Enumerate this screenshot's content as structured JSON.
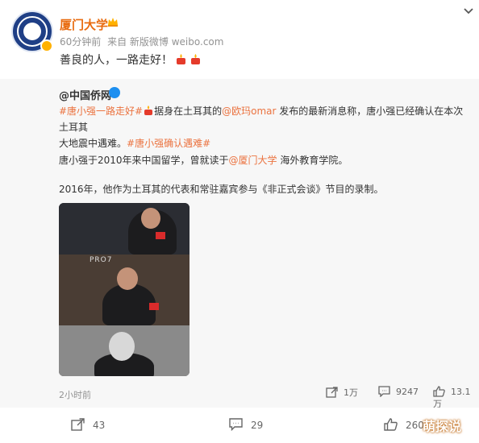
{
  "post": {
    "author": "厦门大学",
    "time": "60分钟前",
    "source": "来自 新版微博 weibo.com",
    "text": "善良的人，一路走好！"
  },
  "repost": {
    "author": "@中国侨网",
    "topic1": "#唐小强一路走好#",
    "line1_a": "据身在土耳其的",
    "mention1": "@欧玛omar",
    "line1_b": " 发布的最新消息称，唐小强已经确认在本次土耳其",
    "line2_a": "大地震中遇难。",
    "topic2": "#唐小强确认遇难#",
    "para2_a": "唐小强于2010年来中国留学，曾就读于",
    "mention2": "@厦门大学",
    "para2_b": " 海外教育学院。",
    "para3": "2016年，他作为土耳其的代表和常驻嘉宾参与《非正式会谈》节目的录制。",
    "photo_text": "PRO7",
    "time": "2小时前",
    "reposts": "1万",
    "comments": "9247",
    "likes": "13.1万"
  },
  "actions": {
    "reposts": "43",
    "comments": "29",
    "likes": "260"
  },
  "watermark": "萌探说",
  "colors": {
    "orange": "#eb7340",
    "verified_blue": "#1d8ff0",
    "gold": "#ffb100"
  },
  "icons": [
    "crown-icon",
    "more-icon",
    "candle-icon",
    "fire-icon",
    "repost-icon",
    "comment-icon",
    "like-icon"
  ]
}
